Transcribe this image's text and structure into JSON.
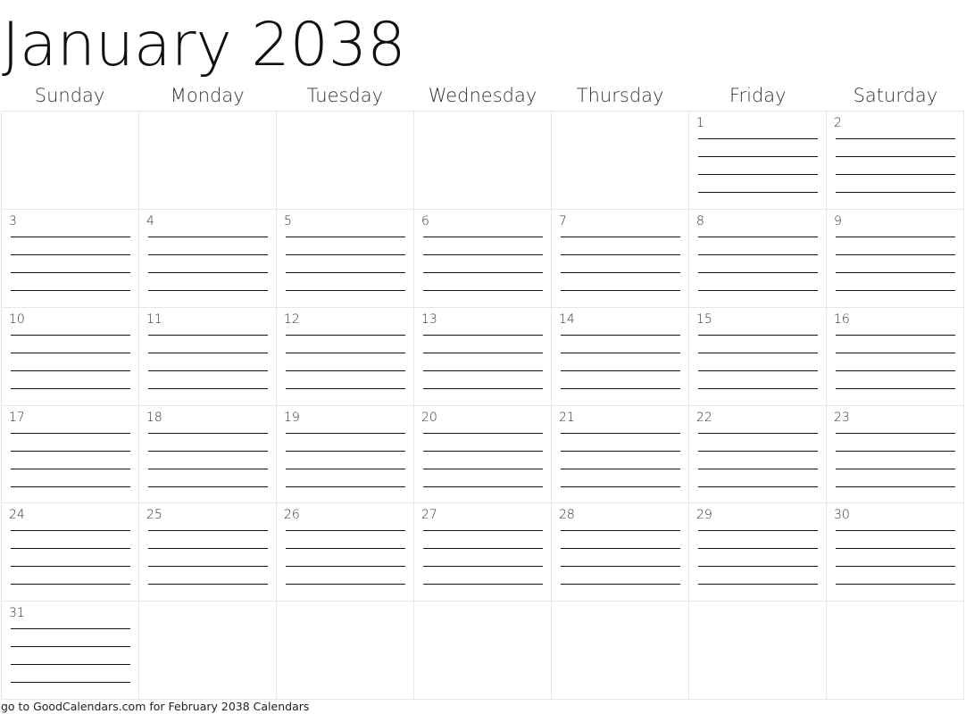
{
  "title": "January 2038",
  "weekdays": [
    "Sunday",
    "Monday",
    "Tuesday",
    "Wednesday",
    "Thursday",
    "Friday",
    "Saturday"
  ],
  "weeks": [
    [
      "",
      "",
      "",
      "",
      "",
      "1",
      "2"
    ],
    [
      "3",
      "4",
      "5",
      "6",
      "7",
      "8",
      "9"
    ],
    [
      "10",
      "11",
      "12",
      "13",
      "14",
      "15",
      "16"
    ],
    [
      "17",
      "18",
      "19",
      "20",
      "21",
      "22",
      "23"
    ],
    [
      "24",
      "25",
      "26",
      "27",
      "28",
      "29",
      "30"
    ],
    [
      "31",
      "",
      "",
      "",
      "",
      "",
      ""
    ]
  ],
  "lines_per_day": 4,
  "footer": "go to GoodCalendars.com for February 2038 Calendars"
}
